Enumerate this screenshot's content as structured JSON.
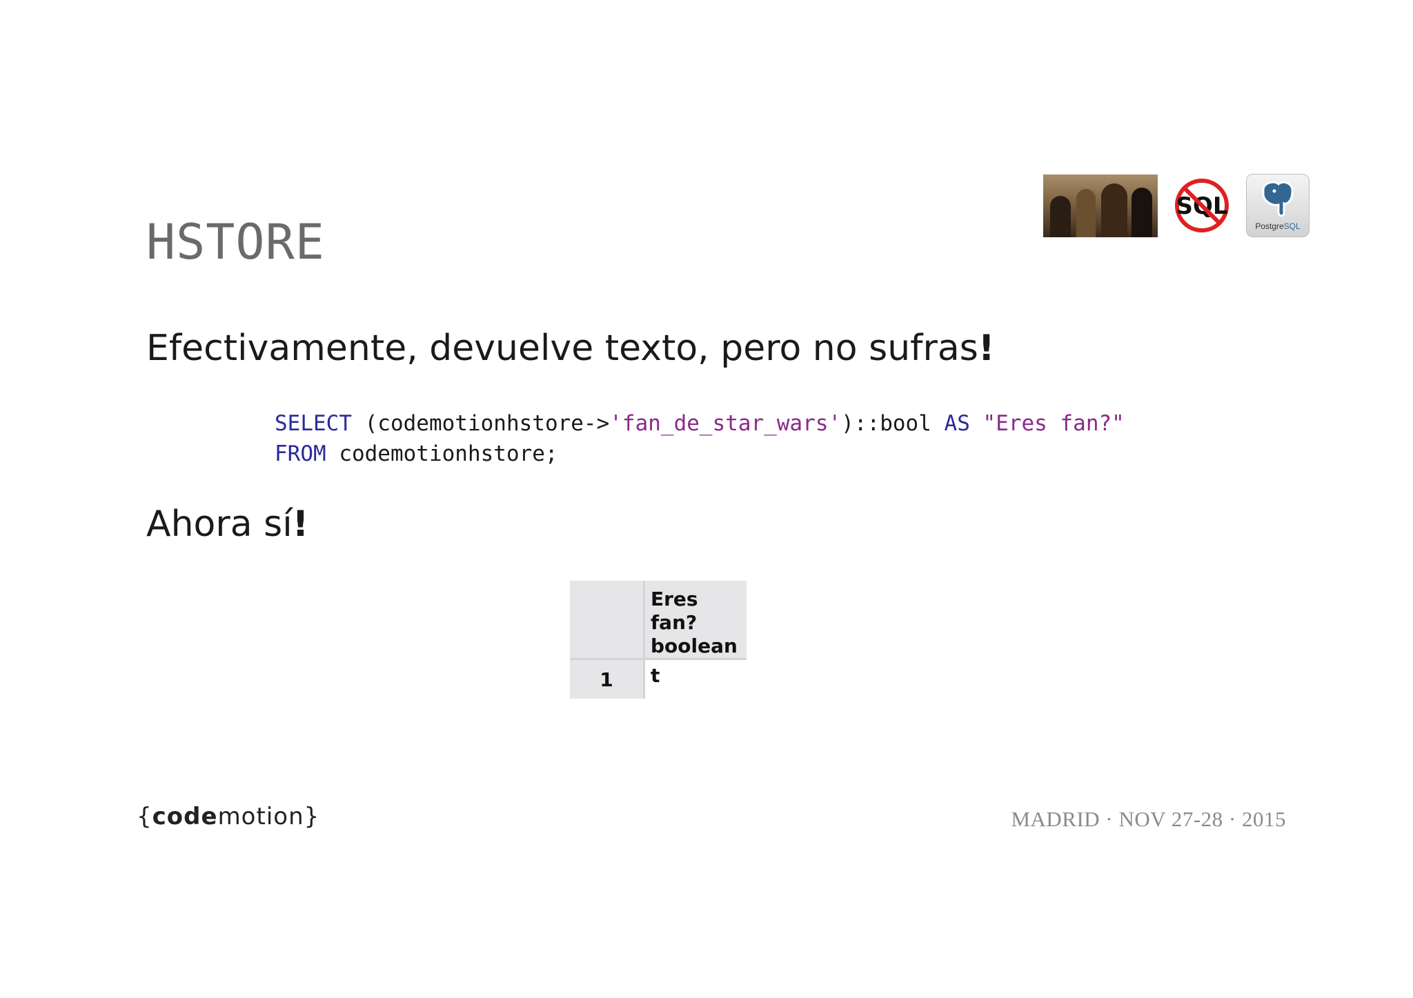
{
  "slide": {
    "title": "HSTORE",
    "line1": "Efectivamente, devuelve texto, pero no sufras",
    "line1_bang": "!",
    "line2": "Ahora sí",
    "line2_bang": "!"
  },
  "code": {
    "l1_kw1": "SELECT",
    "l1_t1": " (codemotionhstore->",
    "l1_str1": "'fan_de_star_wars'",
    "l1_t2": ")::bool ",
    "l1_kw2": "AS",
    "l1_t3": " ",
    "l1_str2": "\"Eres fan?\"",
    "l2_kw1": "FROM",
    "l2_t1": " codemotionhstore;"
  },
  "result_table": {
    "column_name": "Eres fan?",
    "column_type": "boolean",
    "row_number": "1",
    "row_value": "t"
  },
  "header_icons": {
    "nosql_text": "SQL",
    "postgres_text_a": "Postgre",
    "postgres_text_b": "SQL"
  },
  "footer": {
    "logo_open": "{",
    "logo_bold": "code",
    "logo_rest": "motion",
    "logo_close": "}",
    "date": "MADRID · NOV 27-28 · 2015"
  },
  "colors": {
    "keyword": "#2a2a9a",
    "string": "#8a2a8a",
    "title": "#6a6a6a",
    "nosql_red": "#e02020",
    "postgres_blue": "#336791"
  }
}
